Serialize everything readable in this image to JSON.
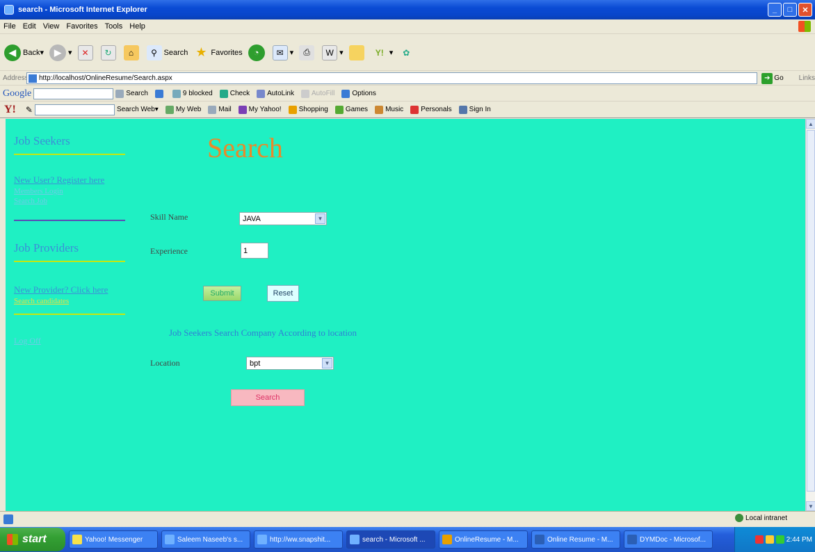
{
  "window": {
    "title": "search - Microsoft Internet Explorer"
  },
  "menu": [
    "File",
    "Edit",
    "View",
    "Favorites",
    "Tools",
    "Help"
  ],
  "toolbar": {
    "back": "Back",
    "search": "Search",
    "favorites": "Favorites"
  },
  "address": {
    "label": "Address",
    "url": "http://localhost/OnlineResume/Search.aspx",
    "go": "Go",
    "links": "Links"
  },
  "googlebar": {
    "logo": "Google",
    "search": "Search",
    "blocked": "9 blocked",
    "check": "Check",
    "autolink": "AutoLink",
    "autofill": "AutoFill",
    "options": "Options"
  },
  "yahoobar": {
    "logo": "Y!",
    "search_web": "Search Web",
    "my_web": "My Web",
    "mail": "Mail",
    "my_yahoo": "My Yahoo!",
    "shopping": "Shopping",
    "games": "Games",
    "music": "Music",
    "personals": "Personals",
    "sign_in": "Sign In"
  },
  "sidebar": {
    "job_seekers": "Job Seekers",
    "new_user": "New User? Register here",
    "members_login": "Members Login",
    "search_job": "Search Job",
    "job_providers": "Job Providers",
    "new_provider": "New Provider? Click here",
    "search_candidates": "Search candidates",
    "log_off": "Log Off"
  },
  "main": {
    "title": "Search",
    "skill_label": "Skill Name",
    "skill_value": "JAVA",
    "experience_label": "Experience",
    "experience_value": "1",
    "submit": "Submit",
    "reset": "Reset",
    "section_text": "Job Seekers Search Company According to location",
    "location_label": "Location",
    "location_value": "bpt",
    "search_button": "Search"
  },
  "status": {
    "zone": "Local intranet"
  },
  "taskbar": {
    "start": "start",
    "tasks": [
      "Yahoo! Messenger",
      "Saleem Naseeb's s...",
      "http://ww.snapshit...",
      "search - Microsoft ...",
      "OnlineResume - M...",
      "Online Resume - M...",
      "DYMDoc - Microsof..."
    ],
    "clock": "2:44 PM"
  },
  "colors": {
    "content_bg": "#1ff0c3",
    "title_color": "#e98a2a",
    "link_color": "#3b8fd8"
  }
}
